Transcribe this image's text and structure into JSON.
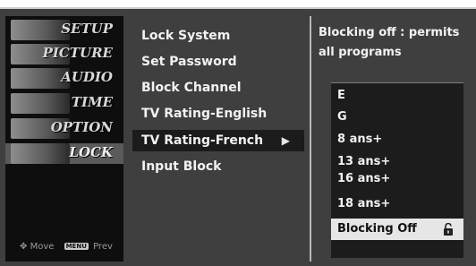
{
  "main_menu": [
    {
      "label": "SETUP"
    },
    {
      "label": "PICTURE"
    },
    {
      "label": "AUDIO"
    },
    {
      "label": "TIME"
    },
    {
      "label": "OPTION"
    },
    {
      "label": "LOCK"
    }
  ],
  "help": {
    "move_label": "Move",
    "menu_key": "MENU",
    "prev_label": "Prev"
  },
  "submenu": [
    {
      "label": "Lock System"
    },
    {
      "label": "Set Password"
    },
    {
      "label": "Block Channel"
    },
    {
      "label": "TV Rating-English"
    },
    {
      "label": "TV Rating-French",
      "arrow": "▶"
    },
    {
      "label": "Input Block"
    }
  ],
  "info_text": "Blocking off : permits all programs",
  "options": [
    {
      "label": "E"
    },
    {
      "label": "G"
    },
    {
      "label": "8 ans+"
    },
    {
      "label": "13 ans+"
    },
    {
      "label": "16 ans+"
    },
    {
      "label": "18 ans+"
    },
    {
      "label": "Blocking Off"
    }
  ],
  "icons": {
    "move": "move-icon",
    "lock": "unlock-icon"
  }
}
